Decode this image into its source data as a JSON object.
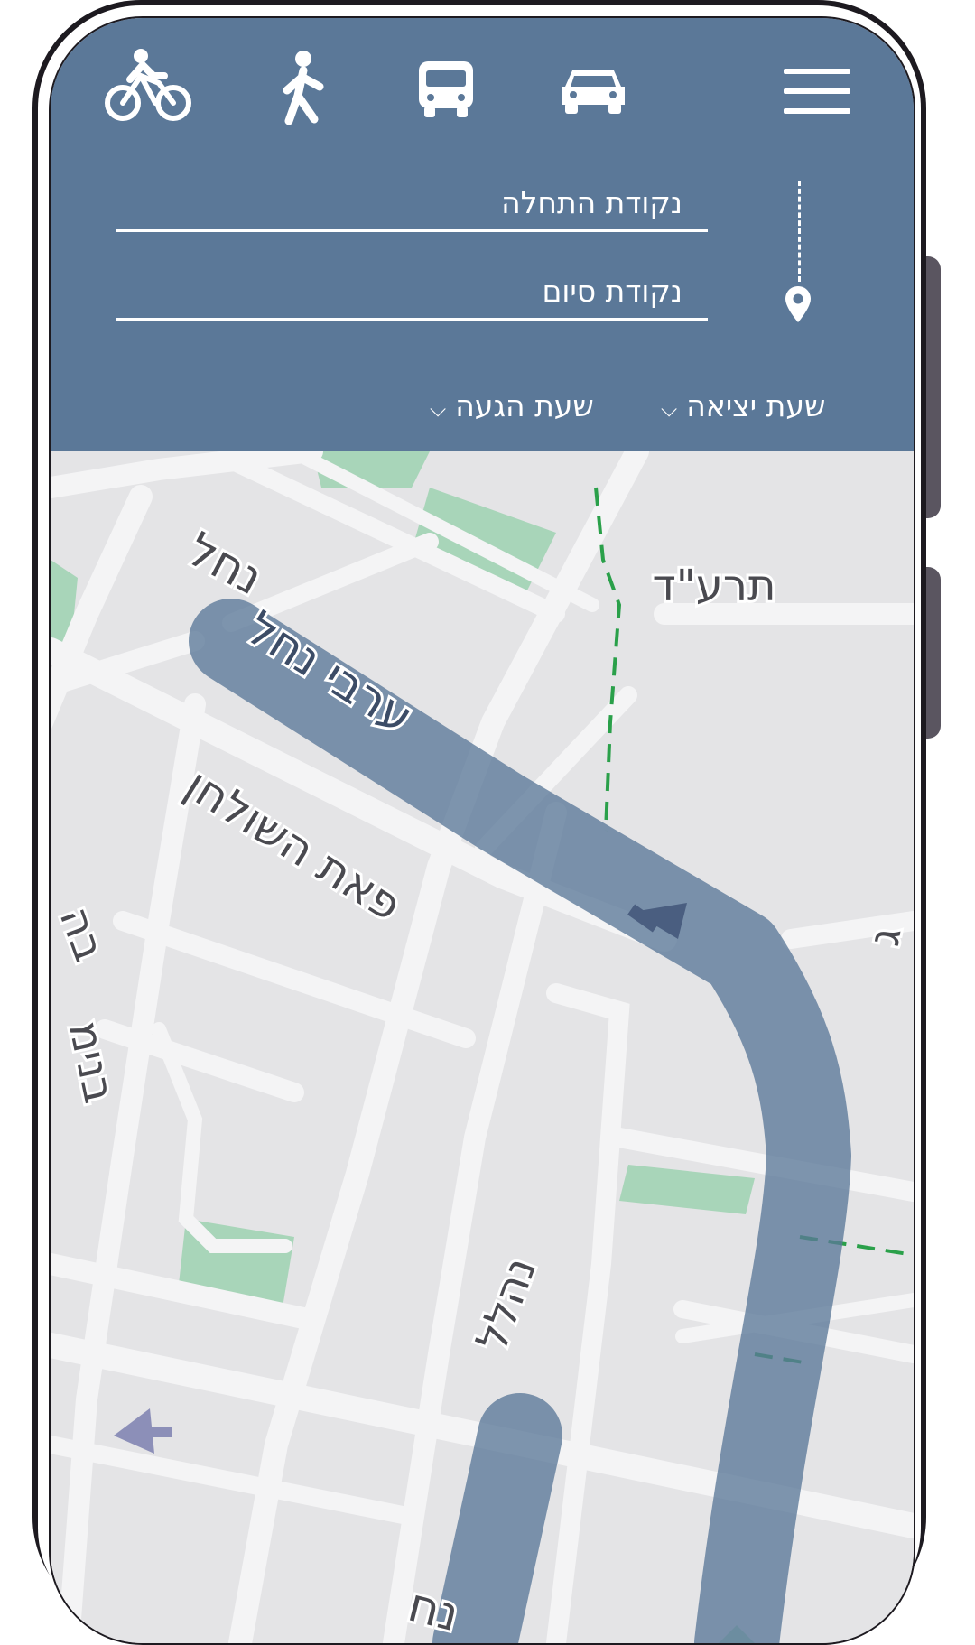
{
  "transport_modes": [
    {
      "name": "bike",
      "icon": "bike-icon"
    },
    {
      "name": "walk",
      "icon": "walk-icon"
    },
    {
      "name": "bus",
      "icon": "bus-icon"
    },
    {
      "name": "car",
      "icon": "car-icon"
    }
  ],
  "menu_icon": "hamburger-menu-icon",
  "route": {
    "start_placeholder": "נקודת התחלה",
    "end_placeholder": "נקודת סיום",
    "pin_icon": "location-pin-icon"
  },
  "time_options": {
    "departure_label": "שעת יציאה",
    "arrival_label": "שעת הגעה",
    "chevron_icon": "chevron-down-icon"
  },
  "map": {
    "street_labels": [
      "נחל",
      "ערבי נחל",
      "תרע\"ד",
      "פאת השולחן",
      "בה",
      "נהלל",
      "בנימ",
      "נח",
      "ג"
    ]
  },
  "colors": {
    "header_bg": "#5b7898",
    "route_line": "#5b7898",
    "map_bg": "#e4e4e6",
    "park": "#a8d5b9",
    "trail": "#2aa04a"
  }
}
